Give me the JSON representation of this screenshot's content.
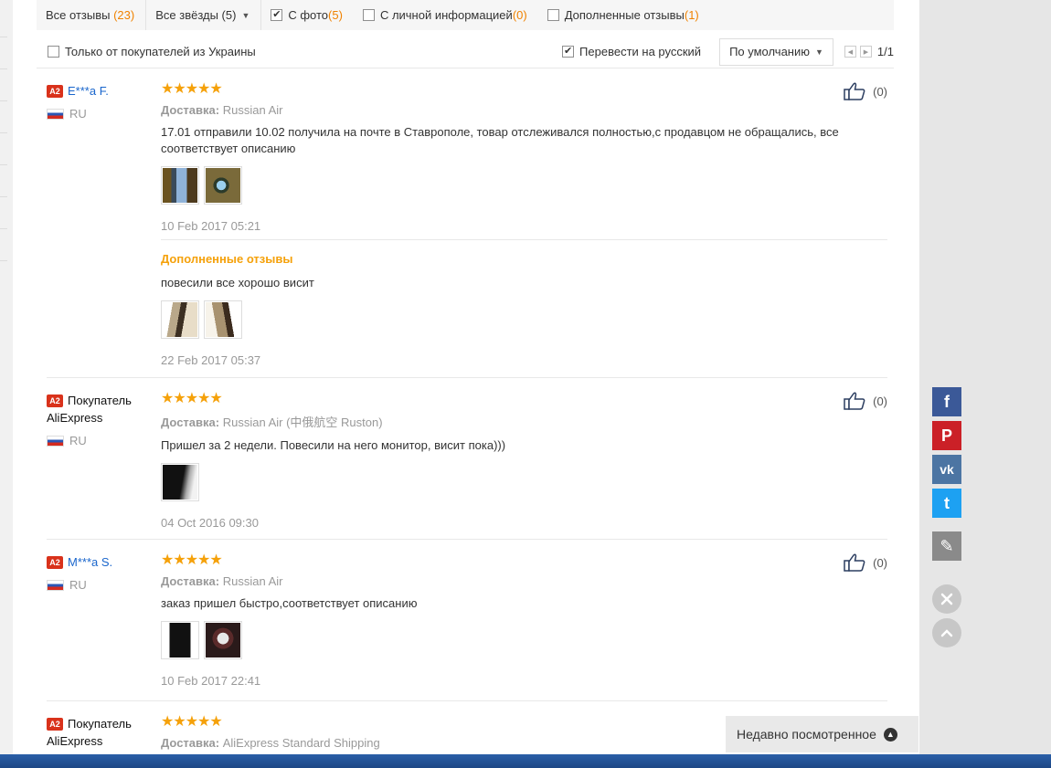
{
  "filters": {
    "all_reviews": {
      "label": "Все отзывы",
      "count": "(23)"
    },
    "all_stars": "Все звёзды (5)",
    "with_photo": {
      "label": "С фото",
      "count": "(5)",
      "checked": true
    },
    "personal_info": {
      "label": "С личной информацией",
      "count": "(0)",
      "checked": false
    },
    "additional": {
      "label": "Дополненные отзывы",
      "count": "(1)",
      "checked": false
    }
  },
  "options": {
    "ukraine_only": "Только от покупателей из Украины",
    "translate": "Перевести на русский",
    "sort": "По умолчанию",
    "page": "1/1"
  },
  "reviews": [
    {
      "name": "E***a F.",
      "country": "RU",
      "ship_label": "Доставка:",
      "ship": "Russian Air",
      "text": "17.01 отправили 10.02 получила на почте в Ставрополе, товар отслеживался полностью,с продавцом не обращались, все соответствует описанию",
      "date": "10 Feb 2017 05:21",
      "likes": "(0)",
      "additional_title": "Дополненные отзывы",
      "additional_text": "повесили все хорошо висит",
      "additional_date": "22 Feb 2017 05:37"
    },
    {
      "name": "Покупатель AliExpress",
      "country": "RU",
      "ship_label": "Доставка:",
      "ship": "Russian Air (中俄航空 Ruston)",
      "text": "Пришел за 2 недели. Повесили на него монитор, висит пока)))",
      "date": "04 Oct 2016 09:30",
      "likes": "(0)"
    },
    {
      "name": "M***a S.",
      "country": "RU",
      "ship_label": "Доставка:",
      "ship": "Russian Air",
      "text": "заказ пришел быстро,соответствует описанию",
      "date": "10 Feb 2017 22:41",
      "likes": "(0)"
    },
    {
      "name": "Покупатель AliExpress",
      "ship_label": "Доставка:",
      "ship": "AliExpress Standard Shipping"
    }
  ],
  "badge": "A2",
  "stars": "★★★★★",
  "social": {
    "facebook": {
      "glyph": "f",
      "color": "#3b5998"
    },
    "pinterest": {
      "glyph": "P",
      "color": "#cb2027"
    },
    "vk": {
      "glyph": "vk",
      "color": "#4c75a3"
    },
    "twitter": {
      "glyph": "t",
      "color": "#1da1f2"
    },
    "edit": {
      "glyph": "✎",
      "color": "#8a8a8a"
    }
  },
  "recently_viewed": "Недавно посмотренное"
}
